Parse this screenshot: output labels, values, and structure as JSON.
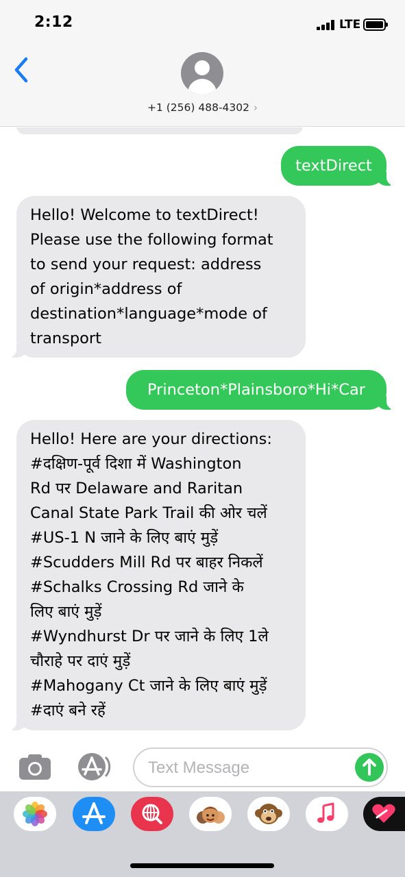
{
  "status_bar": {
    "time": "2:12",
    "network": "LTE"
  },
  "header": {
    "contact": "+1 (256) 488-4302",
    "chevron": "›"
  },
  "messages": [
    {
      "direction": "outgoing",
      "lines": [
        "textDirect"
      ]
    },
    {
      "direction": "incoming",
      "lines": [
        "Hello! Welcome to textDirect!",
        "Please use the following format",
        "to send your request: address",
        "of origin*address of",
        "destination*language*mode of",
        "transport"
      ]
    },
    {
      "direction": "outgoing",
      "lines": [
        "Princeton*Plainsboro*Hi*Car"
      ]
    },
    {
      "direction": "incoming",
      "lines": [
        "Hello! Here are your directions:",
        "#दक्षिण-पूर्व दिशा में Washington",
        "Rd पर Delaware and Raritan",
        "Canal State Park Trail की ओर चलें",
        "#US-1 N जाने के लिए बाएं मुड़ें",
        "#Scudders Mill Rd पर बाहर निकलें",
        "#Schalks Crossing Rd जाने के",
        "लिए बाएं मुड़ें",
        "#Wyndhurst Dr पर जाने के लिए 1ले",
        "चौराहे पर दाएं मुड़ें",
        "#Mahogany Ct जाने के लिए बाएं मुड़ें",
        "#दाएं बने रहें"
      ]
    }
  ],
  "input": {
    "placeholder": "Text Message",
    "value": ""
  },
  "icons": {
    "back": "chevron-left-icon",
    "camera": "camera-icon",
    "appstore": "appstore-icon",
    "send": "arrow-up-icon"
  },
  "app_drawer": [
    "photos-app",
    "app-store-app",
    "web-search-app",
    "memoji-stickers-app",
    "animoji-monkey-app",
    "music-app",
    "digital-touch-app"
  ],
  "colors": {
    "outgoing_bubble": "#34c759",
    "incoming_bubble": "#e9e9eb",
    "accent": "#1a7cf5"
  }
}
